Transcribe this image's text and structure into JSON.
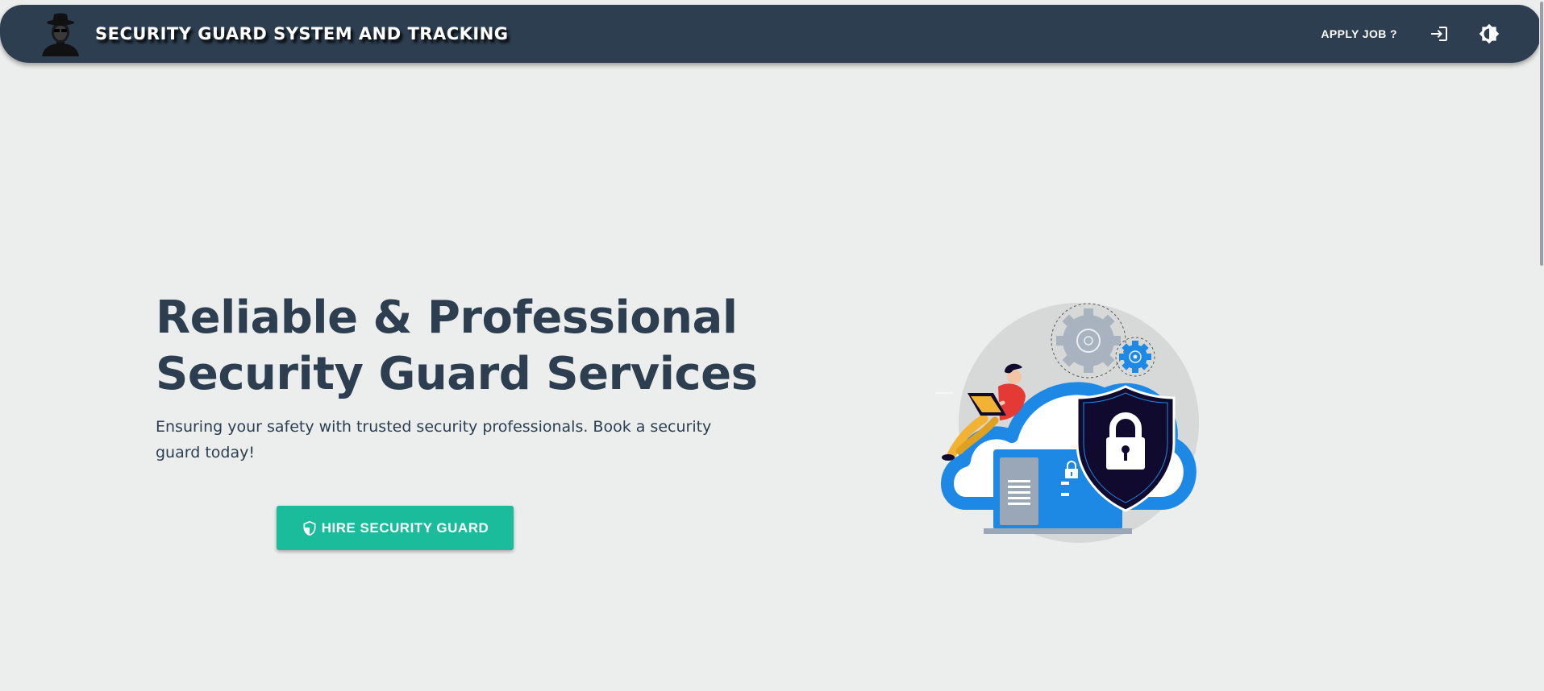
{
  "header": {
    "brand_title": "SECURITY GUARD SYSTEM AND TRACKING",
    "apply_label": "APPLY JOB ?",
    "logo_icon": "security-guard-avatar-icon",
    "login_icon": "login-icon",
    "theme_icon": "brightness-toggle-icon"
  },
  "hero": {
    "title_line1": "Reliable & Professional",
    "title_line2": "Security Guard Services",
    "subtitle": "Ensuring your safety with trusted security professionals. Book a security guard today!",
    "cta_label": "HIRE SECURITY GUARD",
    "cta_icon": "shield-icon",
    "illustration": "cloud-security-illustration"
  },
  "colors": {
    "header_bg": "#2c3e50",
    "page_bg": "#ebeeec",
    "title_text": "#2c3e50",
    "accent": "#1abc9c",
    "illustration_blue": "#1e88e5",
    "shield_dark": "#0f0a2e"
  }
}
